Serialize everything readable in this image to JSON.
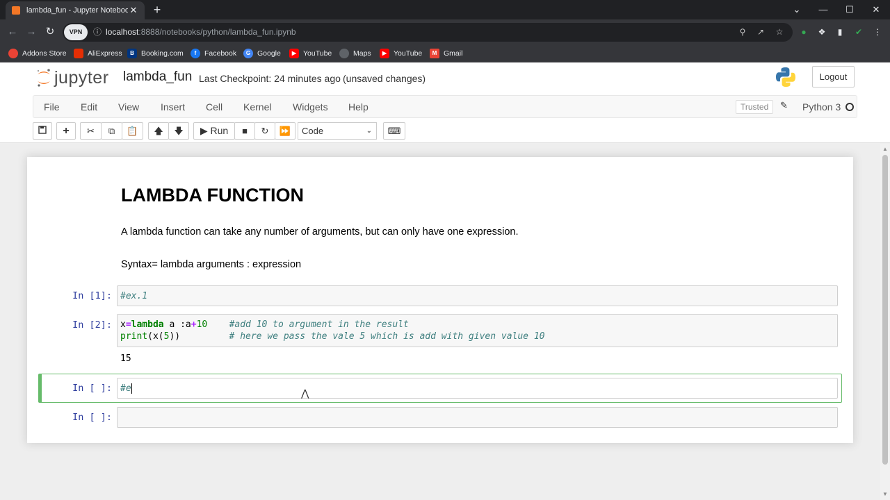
{
  "browser": {
    "tab_title": "lambda_fun - Jupyter Notebook",
    "tab_close": "✕",
    "new_tab": "+",
    "window_controls": {
      "minimize": "—",
      "maximize": "☐",
      "close": "✕",
      "dropdown": "⌄"
    },
    "vpn_label": "VPN",
    "url_host": "localhost",
    "url_rest": ":8888/notebooks/python/lambda_fun.ipynb",
    "bookmarks": [
      {
        "label": "Addons Store",
        "color": "#ea4335"
      },
      {
        "label": "AliExpress",
        "color": "#e62e04"
      },
      {
        "label": "Booking.com",
        "color": "#003580"
      },
      {
        "label": "Facebook",
        "color": "#1877f2"
      },
      {
        "label": "Google",
        "color": "#4285f4"
      },
      {
        "label": "YouTube",
        "color": "#ff0000"
      },
      {
        "label": "Maps",
        "color": "#5f6368"
      },
      {
        "label": "YouTube",
        "color": "#ff0000"
      },
      {
        "label": "Gmail",
        "color": "#ea4335"
      }
    ]
  },
  "jupyter": {
    "logo_text": "jupyter",
    "notebook_name": "lambda_fun",
    "checkpoint": "Last Checkpoint: 24 minutes ago",
    "unsaved": "(unsaved changes)",
    "logout_label": "Logout",
    "menu": [
      "File",
      "Edit",
      "View",
      "Insert",
      "Cell",
      "Kernel",
      "Widgets",
      "Help"
    ],
    "trusted_label": "Trusted",
    "kernel_name": "Python 3",
    "run_label": "Run",
    "cell_type": "Code"
  },
  "notebook": {
    "heading": "LAMBDA FUNCTION",
    "paragraph1": "A lambda function can take any number of arguments, but can only have one expression.",
    "paragraph2": "Syntax= lambda arguments : expression",
    "cells": [
      {
        "prompt": "In [1]:",
        "code": "#ex.1"
      },
      {
        "prompt": "In [2]:",
        "line1_comment": "#add 10 to argument in the result",
        "line2_comment": "# here we pass the vale 5 which is add with given value 10",
        "output": "15"
      },
      {
        "prompt": "In [ ]:",
        "code": "#e"
      },
      {
        "prompt": "In [ ]:",
        "code": ""
      }
    ]
  },
  "colors": {
    "chrome_dark": "#202124",
    "prompt_blue": "#303f9f",
    "selected_green": "#66bb6a",
    "comment_teal": "#408080"
  }
}
